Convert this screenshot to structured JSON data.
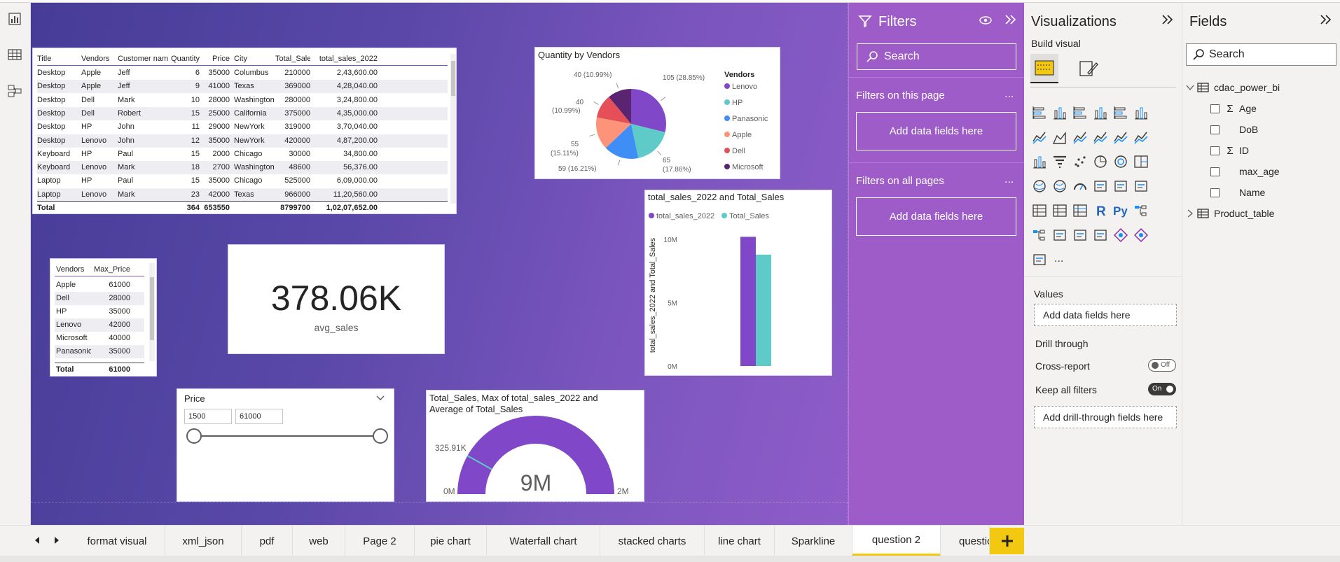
{
  "leftbar": {
    "icons": [
      "report-view-icon",
      "table-view-icon",
      "model-view-icon"
    ]
  },
  "sales_table": {
    "columns": [
      "Title",
      "Vendors",
      "Customer name",
      "Quantity",
      "Price",
      "City",
      "Total_Sales",
      "total_sales_2022"
    ],
    "rows": [
      [
        "Desktop",
        "Apple",
        "Jeff",
        "6",
        "35000",
        "Columbus",
        "210000",
        "2,43,600.00"
      ],
      [
        "Desktop",
        "Apple",
        "Jeff",
        "9",
        "41000",
        "Texas",
        "369000",
        "4,28,040.00"
      ],
      [
        "Desktop",
        "Dell",
        "Mark",
        "10",
        "28000",
        "Washington",
        "280000",
        "3,24,800.00"
      ],
      [
        "Desktop",
        "Dell",
        "Robert",
        "15",
        "25000",
        "California",
        "375000",
        "4,35,000.00"
      ],
      [
        "Desktop",
        "HP",
        "John",
        "11",
        "29000",
        "NewYork",
        "319000",
        "3,70,040.00"
      ],
      [
        "Desktop",
        "Lenovo",
        "John",
        "12",
        "35000",
        "NewYork",
        "420000",
        "4,87,200.00"
      ],
      [
        "Keyboard",
        "HP",
        "Paul",
        "15",
        "2000",
        "Chicago",
        "30000",
        "34,800.00"
      ],
      [
        "Keyboard",
        "Lenovo",
        "Mark",
        "18",
        "2700",
        "Washington",
        "48600",
        "56,376.00"
      ],
      [
        "Laptop",
        "HP",
        "Paul",
        "15",
        "35000",
        "Chicago",
        "525000",
        "6,09,000.00"
      ],
      [
        "Laptop",
        "Lenovo",
        "Mark",
        "23",
        "42000",
        "Texas",
        "966000",
        "11,20,560.00"
      ]
    ],
    "total": [
      "Total",
      "",
      "",
      "364",
      "653550",
      "",
      "8799700",
      "1,02,07,652.00"
    ]
  },
  "max_price_table": {
    "columns": [
      "Vendors",
      "Max_Price"
    ],
    "rows": [
      [
        "Apple",
        "61000"
      ],
      [
        "Dell",
        "28000"
      ],
      [
        "HP",
        "35000"
      ],
      [
        "Lenovo",
        "42000"
      ],
      [
        "Microsoft",
        "40000"
      ],
      [
        "Panasonic",
        "35000"
      ]
    ],
    "total": [
      "Total",
      "61000"
    ]
  },
  "card": {
    "value": "378.06K",
    "label": "avg_sales"
  },
  "slicer": {
    "title": "Price",
    "min": "1500",
    "max": "61000"
  },
  "chart_data": [
    {
      "type": "pie",
      "title": "Quantity by Vendors",
      "legend_title": "Vendors",
      "legend_position": "right",
      "slices": [
        {
          "name": "Lenovo",
          "value": 105,
          "label": "105 (28.85%)",
          "color": "#8048c8"
        },
        {
          "name": "HP",
          "value": 65,
          "label": "65 (17.86%)",
          "color": "#5ecbc8"
        },
        {
          "name": "Panasonic",
          "value": 59,
          "label": "59 (16.21%)",
          "color": "#3f8ef5"
        },
        {
          "name": "Apple",
          "value": 55,
          "label": "55 (15.11%)",
          "color": "#fd9378"
        },
        {
          "name": "Dell",
          "value": 40,
          "label": "40 (10.99%)",
          "color": "#e54f58"
        },
        {
          "name": "Microsoft",
          "value": 40,
          "label": "40 (10.99%)",
          "color": "#5a2470"
        }
      ]
    },
    {
      "type": "bar",
      "title": "total_sales_2022 and Total_Sales",
      "ylabel": "total_sales_2022 and Total_Sales",
      "legend_position": "top-left",
      "ylim": [
        0,
        11000000
      ],
      "yticks": [
        "0M",
        "5M",
        "10M"
      ],
      "ytick_values": [
        0,
        5000000,
        10000000
      ],
      "series": [
        {
          "name": "total_sales_2022",
          "value": 10207652,
          "color": "#8048c8"
        },
        {
          "name": "Total_Sales",
          "value": 8799700,
          "color": "#5ecbc8"
        }
      ]
    },
    {
      "type": "gauge",
      "title": "Total_Sales, Max of total_sales_2022 and Average of Total_Sales",
      "min_label": "0M",
      "max_label": "2M",
      "min": 0,
      "max": 2000000,
      "value_label": "9M",
      "target_label": "325.91K",
      "target": 325910,
      "color": "#8048c8"
    }
  ],
  "filters": {
    "title": "Filters",
    "search_placeholder": "Search",
    "on_this_page": "Filters on this page",
    "on_all_pages": "Filters on all pages",
    "add_fields": "Add data fields here",
    "more": "..."
  },
  "visualizations": {
    "title": "Visualizations",
    "build_visual": "Build visual",
    "values_label": "Values",
    "values_placeholder": "Add data fields here",
    "drill_through": "Drill through",
    "cross_report": "Cross-report",
    "cross_report_state": "Off",
    "keep_all_filters": "Keep all filters",
    "keep_all_filters_state": "On",
    "drill_placeholder": "Add drill-through fields here",
    "more_visuals": "...",
    "r_label": "R",
    "py_label": "Py"
  },
  "fields": {
    "title": "Fields",
    "search_placeholder": "Search",
    "tables": [
      {
        "name": "cdac_power_bi",
        "expanded": true,
        "columns": [
          {
            "name": "Age",
            "sigma": true
          },
          {
            "name": "DoB",
            "sigma": false
          },
          {
            "name": "ID",
            "sigma": true
          },
          {
            "name": "max_age",
            "sigma": false
          },
          {
            "name": "Name",
            "sigma": false
          }
        ]
      },
      {
        "name": "Product_table",
        "expanded": false,
        "columns": []
      }
    ]
  },
  "tabs": [
    "format visual",
    "xml_json",
    "pdf",
    "web",
    "Page 2",
    "pie chart",
    "Waterfall chart",
    "stacked charts",
    "line chart",
    "Sparkline",
    "question 2",
    "questio"
  ],
  "active_tab": "question 2",
  "colors": {
    "accent": "#f2c811",
    "filters_bg": "#9d5cc8",
    "canvas_start": "#463c97",
    "canvas_end": "#8f5cc8"
  }
}
